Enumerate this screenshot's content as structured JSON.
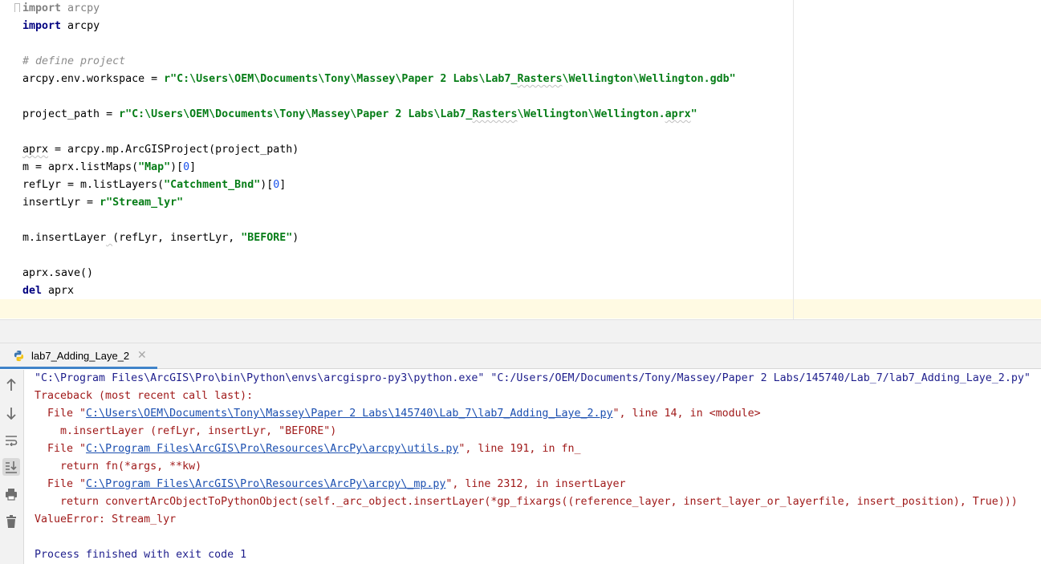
{
  "editor": {
    "lines": [
      {
        "parts": [
          {
            "t": "import",
            "c": "kw faded"
          },
          {
            "t": " arcpy",
            "c": "faded"
          }
        ]
      },
      {
        "parts": [
          {
            "t": "import",
            "c": "kw"
          },
          {
            "t": " arcpy",
            "c": ""
          }
        ]
      },
      {
        "parts": []
      },
      {
        "parts": [
          {
            "t": "# define project",
            "c": "cmt"
          }
        ]
      },
      {
        "parts": [
          {
            "t": "arcpy.env.workspace = ",
            "c": ""
          },
          {
            "t": "r\"C:\\Users\\OEM\\Documents\\Tony\\Massey\\Paper 2 Labs\\Lab7_",
            "c": "str"
          },
          {
            "t": "Rasters",
            "c": "str squig"
          },
          {
            "t": "\\Wellington\\Wellington.gdb\"",
            "c": "str"
          }
        ]
      },
      {
        "parts": []
      },
      {
        "parts": [
          {
            "t": "project_path = ",
            "c": ""
          },
          {
            "t": "r\"C:\\Users\\OEM\\Documents\\Tony\\Massey\\Paper 2 Labs\\Lab7_",
            "c": "str"
          },
          {
            "t": "Rasters",
            "c": "str squig"
          },
          {
            "t": "\\Wellington\\Wellington.",
            "c": "str"
          },
          {
            "t": "aprx",
            "c": "str squig"
          },
          {
            "t": "\"",
            "c": "str"
          }
        ]
      },
      {
        "parts": []
      },
      {
        "parts": [
          {
            "t": "aprx",
            "c": "squig"
          },
          {
            "t": " = arcpy.mp.ArcGISProject(project_path)",
            "c": ""
          }
        ]
      },
      {
        "parts": [
          {
            "t": "m = aprx.listMaps(",
            "c": ""
          },
          {
            "t": "\"Map\"",
            "c": "str"
          },
          {
            "t": ")[",
            "c": ""
          },
          {
            "t": "0",
            "c": "num"
          },
          {
            "t": "]",
            "c": ""
          }
        ]
      },
      {
        "parts": [
          {
            "t": "refLyr = m.listLayers(",
            "c": ""
          },
          {
            "t": "\"Catchment_Bnd\"",
            "c": "str"
          },
          {
            "t": ")[",
            "c": ""
          },
          {
            "t": "0",
            "c": "num"
          },
          {
            "t": "]",
            "c": ""
          }
        ]
      },
      {
        "parts": [
          {
            "t": "insertLyr = ",
            "c": ""
          },
          {
            "t": "r\"Stream_lyr\"",
            "c": "str"
          }
        ]
      },
      {
        "parts": []
      },
      {
        "parts": [
          {
            "t": "m.insertLayer",
            "c": ""
          },
          {
            "t": " ",
            "c": "squig"
          },
          {
            "t": "(refLyr, insertLyr, ",
            "c": ""
          },
          {
            "t": "\"BEFORE\"",
            "c": "str"
          },
          {
            "t": ")",
            "c": ""
          }
        ]
      },
      {
        "parts": []
      },
      {
        "parts": [
          {
            "t": "aprx.save()",
            "c": ""
          }
        ]
      },
      {
        "parts": [
          {
            "t": "del",
            "c": "kw"
          },
          {
            "t": " aprx",
            "c": ""
          }
        ]
      },
      {
        "parts": []
      }
    ]
  },
  "run": {
    "tab_label": "lab7_Adding_Laye_2",
    "toolbar": [
      "up-arrow-icon",
      "down-arrow-icon",
      "soft-wrap-icon",
      "scroll-to-end-icon",
      "print-icon",
      "trash-icon"
    ],
    "console": [
      {
        "cls": "cmd",
        "indent": 0,
        "parts": [
          {
            "t": "\"C:\\Program Files\\ArcGIS\\Pro\\bin\\Python\\envs\\arcgispro-py3\\python.exe\" \"C:/Users/OEM/Documents/Tony/Massey/Paper 2 Labs/145740/Lab_7/lab7_Adding_Laye_2.py\"",
            "c": ""
          }
        ]
      },
      {
        "cls": "",
        "indent": 0,
        "parts": [
          {
            "t": "Traceback (most recent call last):",
            "c": ""
          }
        ]
      },
      {
        "cls": "",
        "indent": 2,
        "parts": [
          {
            "t": "File \"",
            "c": ""
          },
          {
            "t": "C:\\Users\\OEM\\Documents\\Tony\\Massey\\Paper 2 Labs\\145740\\Lab_7\\lab7_Adding_Laye_2.py",
            "c": "link"
          },
          {
            "t": "\", line 14, in <module>",
            "c": ""
          }
        ]
      },
      {
        "cls": "",
        "indent": 4,
        "parts": [
          {
            "t": "m.insertLayer (refLyr, insertLyr, \"BEFORE\")",
            "c": ""
          }
        ]
      },
      {
        "cls": "",
        "indent": 2,
        "parts": [
          {
            "t": "File \"",
            "c": ""
          },
          {
            "t": "C:\\Program Files\\ArcGIS\\Pro\\Resources\\ArcPy\\arcpy\\utils.py",
            "c": "link"
          },
          {
            "t": "\", line 191, in fn_",
            "c": ""
          }
        ]
      },
      {
        "cls": "",
        "indent": 4,
        "parts": [
          {
            "t": "return fn(*args, **kw)",
            "c": ""
          }
        ]
      },
      {
        "cls": "",
        "indent": 2,
        "parts": [
          {
            "t": "File \"",
            "c": ""
          },
          {
            "t": "C:\\Program Files\\ArcGIS\\Pro\\Resources\\ArcPy\\arcpy\\_mp.py",
            "c": "link"
          },
          {
            "t": "\", line 2312, in insertLayer",
            "c": ""
          }
        ]
      },
      {
        "cls": "",
        "indent": 4,
        "parts": [
          {
            "t": "return convertArcObjectToPythonObject(self._arc_object.insertLayer(*gp_fixargs((reference_layer, insert_layer_or_layerfile, insert_position), True)))",
            "c": ""
          }
        ]
      },
      {
        "cls": "",
        "indent": 0,
        "parts": [
          {
            "t": "ValueError: Stream_lyr",
            "c": ""
          }
        ]
      },
      {
        "cls": "",
        "indent": 0,
        "parts": []
      },
      {
        "cls": "done",
        "indent": 0,
        "parts": [
          {
            "t": "Process finished with exit code 1",
            "c": ""
          }
        ]
      }
    ]
  }
}
